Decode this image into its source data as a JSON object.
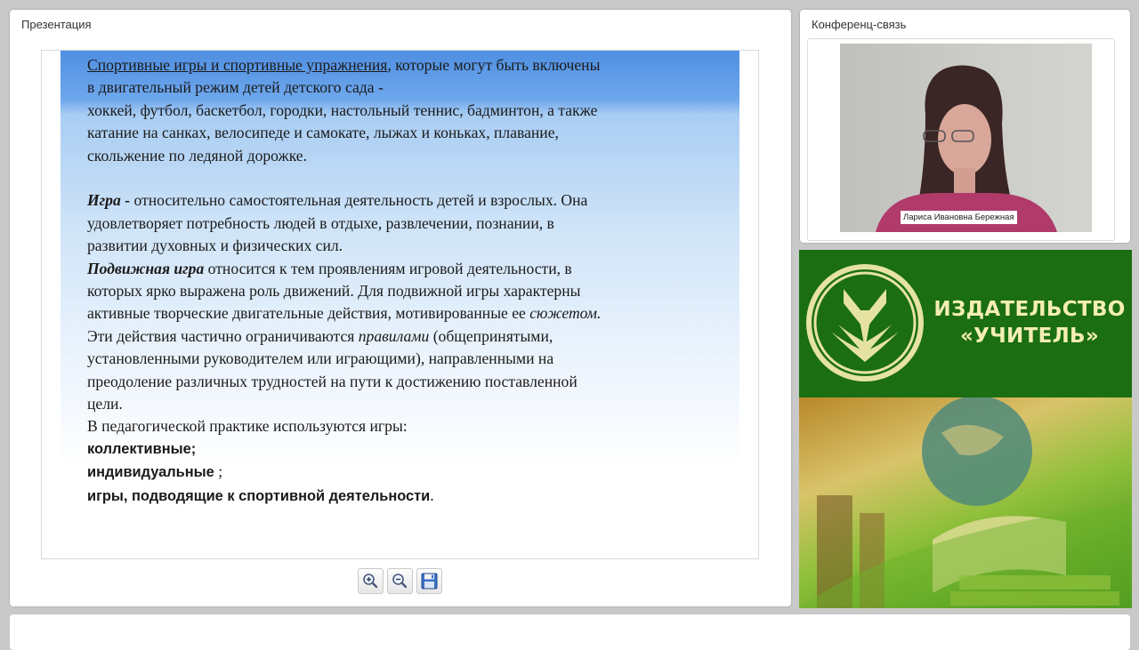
{
  "presentation": {
    "title": "Презентация",
    "slide": {
      "p1_link": "Спортивные игры и спортивные упражнения",
      "p1_rest": ", которые могут быть включены",
      "p1_l2": "в двигательный режим  детей детского сада -",
      "p1_l3": "хоккей, футбол, баскетбол, городки, настольный теннис, бадминтон, а также",
      "p1_l4": "катание на санках, велосипеде и самокате, лыжах и коньках, плавание,",
      "p1_l5": "скольжение по ледяной дорожке.",
      "p2_term": "Игра",
      "p2_dash": " - ",
      "p2_l1_rest": "относительно самостоятельная деятельность детей и взрослых. Она",
      "p2_l2": "удовлетворяет потребность людей в отдыхе, развлечении, познании, в",
      "p2_l3": "развитии духовных и физических сил.",
      "p3_term": "Подвижная игра",
      "p3_l1_rest": " относится к тем проявлениям игровой деятельности, в",
      "p3_l2": "которых ярко выражена роль движений. Для подвижной игры характерны",
      "p3_l3_a": "активные творческие двигательные действия, мотивированные ее ",
      "p3_l3_em": "сюжетом.",
      "p3_l4_a": "Эти действия частично ограничиваются ",
      "p3_l4_em": "правилами",
      "p3_l4_b": " (общепринятыми,",
      "p3_l5": "установленными руководителем или играющими), направленными на",
      "p3_l6": "преодоление различных трудностей на пути к достижению поставленной",
      "p3_l7": "цели.",
      "p4_l1": "В педагогической практике используются игры:",
      "p4_b1": "коллективные;",
      "p4_b2_a": " индивидуальные ",
      "p4_b2_b": ";",
      "p4_b3_a": "игры, подводящие к спортивной деятельности",
      "p4_b3_b": "."
    },
    "toolbar": {
      "zoom_in_icon": "zoom-in-icon",
      "zoom_out_icon": "zoom-out-icon",
      "save_icon": "floppy-disk-icon"
    }
  },
  "conference": {
    "title": "Конференц-связь",
    "speaker_name": "Лариса Ивановна Бережная"
  },
  "ad": {
    "publisher_line1": "ИЗДАТЕЛЬСТВО",
    "publisher_line2": "«УЧИТЕЛЬ»",
    "accent_green": "#1b6e12",
    "text_color": "#f4eeb4"
  }
}
